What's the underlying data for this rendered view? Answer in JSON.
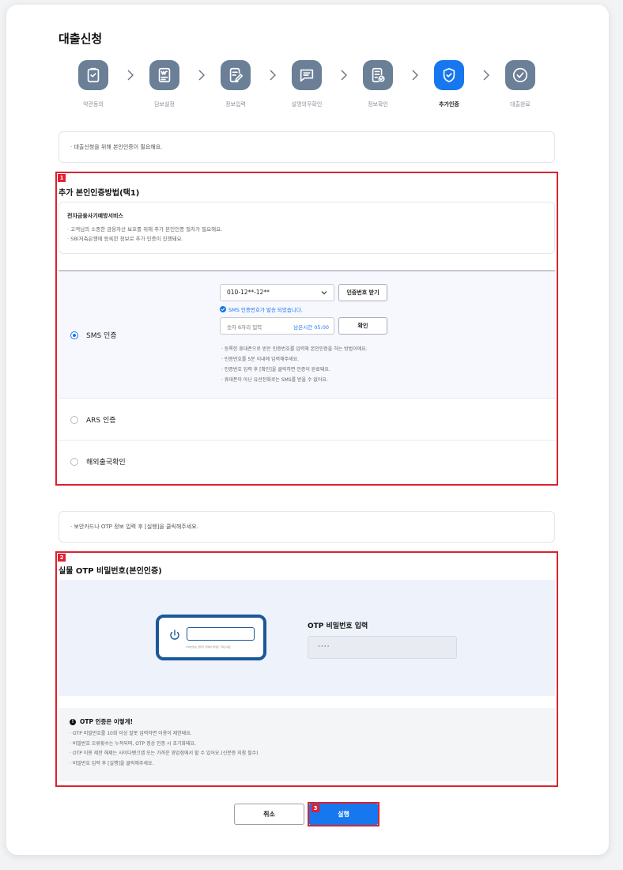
{
  "page": {
    "title": "대출신청"
  },
  "steps": [
    {
      "label": "약관동의",
      "icon": "checklist-icon",
      "active": false
    },
    {
      "label": "담보설정",
      "icon": "document-won-icon",
      "active": false
    },
    {
      "label": "정보입력",
      "icon": "edit-document-icon",
      "active": false
    },
    {
      "label": "설명의무확인",
      "icon": "message-icon",
      "active": false
    },
    {
      "label": "정보확인",
      "icon": "document-check-icon",
      "active": false
    },
    {
      "label": "추가인증",
      "icon": "shield-check-icon",
      "active": true
    },
    {
      "label": "대출완료",
      "icon": "circle-check-icon",
      "active": false
    }
  ],
  "notice1": "· 대출신청을 위해 본인인증이 필요해요.",
  "auth_section": {
    "marker": "1",
    "title": "추가 본인인증방법(택1)",
    "info_title": "전자금융사기예방서비스",
    "info_lines": [
      "· 고객님의 소중한 금융자산 보호를 위해 추가 본인인증 절차가 필요해요.",
      "· SBI저축은행에 등록한 정보로 추가 인증이 진행돼요."
    ],
    "options": [
      {
        "label": "SMS 인증",
        "selected": true
      },
      {
        "label": "ARS 인증",
        "selected": false
      },
      {
        "label": "해외출국확인",
        "selected": false
      }
    ],
    "sms": {
      "phone_value": "010-12**-12**",
      "request_button": "인증번호 받기",
      "sent_message": "SMS 인증번호가 발송 되었습니다.",
      "code_placeholder": "숫자 6자리 입력",
      "timer_text": "남은시간 05:00",
      "confirm_button": "확인",
      "bullets": [
        "· 등록한 휴대폰으로 받은 인증번호를 입력해 본인인증을 하는 방법이에요.",
        "· 인증번호를 5분 이내에 입력해주세요.",
        "· 인증번호 입력 후 [확인]을 클릭하면 인증이 완료돼요.",
        "· 휴대폰이 아닌 유선전화로는 SMS를 받을 수 없어요."
      ]
    }
  },
  "notice2": "· 보안카드나 OTP 정보 입력 후 [실행]을 클릭해주세요.",
  "otp_section": {
    "marker": "2",
    "title": "실물 OTP 비밀번호(본인인증)",
    "device_caption": "OTP번호는 형태가 판매처 형태로 가져오세요",
    "input_label": "OTP 비밀번호 입력",
    "input_value": "····",
    "help_title": "OTP 인증은 이렇게!",
    "help_lines": [
      "· OTP 비밀번호를 10회 이상 잘못 입력하면 이용이 제한돼요.",
      "· 비밀번호 오류횟수는 누적되며, OTP 정상 인증 시 초기화돼요.",
      "· OTP 이용 제한 해제는 사이다뱅크앱 또는 가까운 영업점에서 할 수 있어요.(신분증 지참 필수)",
      "· 비밀번호 입력 후 [실행]을 클릭해주세요."
    ]
  },
  "actions": {
    "cancel": "취소",
    "run": "실행",
    "run_marker": "3"
  },
  "colors": {
    "accent": "#1677ee",
    "step_inactive": "#6b7f97",
    "highlight_red": "#d9232f",
    "otp_device": "#1b5799"
  }
}
